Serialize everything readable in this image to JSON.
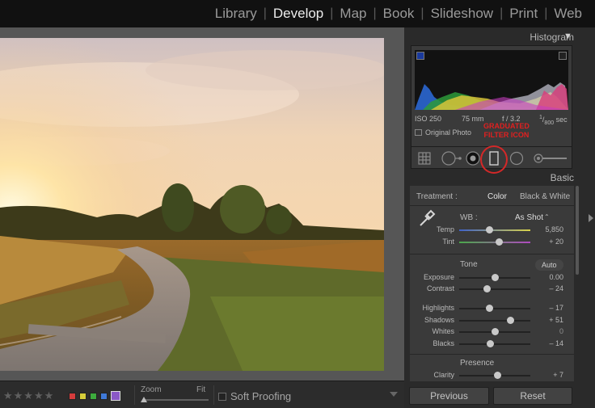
{
  "modules": {
    "library": "Library",
    "develop": "Develop",
    "map": "Map",
    "book": "Book",
    "slideshow": "Slideshow",
    "print": "Print",
    "web": "Web",
    "separator": "|",
    "active": "Develop"
  },
  "toolbar": {
    "stars": "★★★★★",
    "color_labels": [
      "#d43c3c",
      "#d6cd3a",
      "#3dab3d",
      "#3f79d8",
      "#8a58c7"
    ],
    "zoom_label": "Zoom",
    "fit_label": "Fit",
    "zoom_level": 0,
    "soft_proofing": "Soft Proofing"
  },
  "panel": {
    "histogram_title": "Histogram",
    "iso": "ISO 250",
    "focal": "75 mm",
    "aperture": "f / 3.2",
    "shutter_num": "1",
    "shutter_den": "800",
    "shutter_unit": "sec",
    "original_photo": "Original Photo",
    "annotation_line1": "GRADUATED",
    "annotation_line2": "FILTER ICON",
    "basic_title": "Basic",
    "treatment_label": "Treatment :",
    "treatment_color": "Color",
    "treatment_bw": "Black & White",
    "wb_label": "WB :",
    "wb_value": "As Shot",
    "temp_label": "Temp",
    "temp_value": "5,850",
    "temp_level": 0.42,
    "tint_label": "Tint",
    "tint_value": "+ 20",
    "tint_level": 0.56,
    "tone_label": "Tone",
    "auto_label": "Auto",
    "exposure_label": "Exposure",
    "exposure_value": "0.00",
    "exposure_level": 0.5,
    "contrast_label": "Contrast",
    "contrast_value": "– 24",
    "contrast_level": 0.39,
    "highlights_label": "Highlights",
    "highlights_value": "– 17",
    "highlights_level": 0.42,
    "shadows_label": "Shadows",
    "shadows_value": "+ 51",
    "shadows_level": 0.72,
    "whites_label": "Whites",
    "whites_value": "0",
    "whites_level": 0.5,
    "blacks_label": "Blacks",
    "blacks_value": "– 14",
    "blacks_level": 0.43,
    "presence_label": "Presence",
    "clarity_label": "Clarity",
    "clarity_value": "+ 7",
    "clarity_level": 0.53,
    "previous": "Previous",
    "reset": "Reset"
  }
}
